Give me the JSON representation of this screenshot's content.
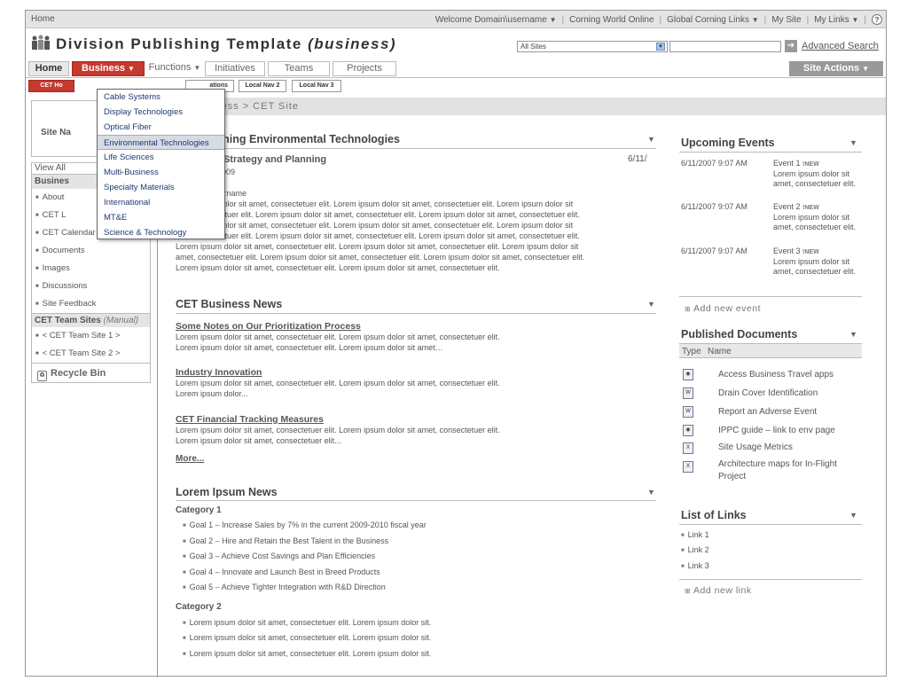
{
  "topbar": {
    "home": "Home",
    "welcome": "Welcome Domain\\username",
    "corning_world": "Corning World Online",
    "global_links": "Global Corning Links",
    "my_site": "My Site",
    "my_links": "My Links",
    "help": "?"
  },
  "header": {
    "title_plain": "Division Publishing Template",
    "title_italic": "(business)",
    "scope": "All Sites",
    "advanced_search": "Advanced Search"
  },
  "tabs": {
    "home": "Home",
    "business": "Business",
    "functions": "Functions",
    "initiatives": "Initiatives",
    "teams": "Teams",
    "projects": "Projects",
    "site_actions": "Site Actions"
  },
  "subnav": {
    "cet_home": "CET Ho",
    "operations": "ations",
    "local2": "Local Nav 2",
    "local3": "Local Nav 3"
  },
  "breadcrumb": "Business > CET Site",
  "dropdown": {
    "items": [
      "Cable Systems",
      "Display Technologies",
      "Optical Fiber",
      "Environmental Technologies",
      "Life Sciences",
      "Multi-Business",
      "Specialty Materials",
      "International",
      "MT&E",
      "Science & Technology"
    ]
  },
  "leftnav": {
    "site_nav": "Site Na",
    "view_all": "View All",
    "section_head": "Busines",
    "items": [
      "About",
      "CET L",
      "CET Calendar",
      "Documents",
      "Images",
      "Discussions",
      "Site Feedback"
    ],
    "team_head": "CET Team Sites",
    "team_head_note": "(Manual)",
    "team_sites": [
      "< CET Team Site 1 >",
      "< CET Team Site 2 >"
    ],
    "recycle": "Recycle Bin"
  },
  "main": {
    "cet_title": "t Corning Environmental Technologies",
    "article_title": "-Year Strategy and Planning",
    "article_date": "6/11/",
    "article_sub": "mber 2009",
    "article_author": "ain\\Username",
    "article_lines": [
      "psum dolor sit amet, consectetuer elit. Lorem ipsum dolor sit amet, consectetuer elit. Lorem ipsum dolor sit",
      "onsectetuer elit. Lorem ipsum dolor sit amet, consectetuer elit.  Lorem ipsum dolor sit amet, consectetuer elit.",
      "psum dolor sit amet, consectetuer elit. Lorem ipsum dolor sit amet, consectetuer elit. Lorem ipsum dolor sit",
      "onsectetuer elit.  Lorem ipsum dolor sit amet, consectetuer elit. Lorem ipsum dolor sit amet, consectetuer elit.",
      "Lorem ipsum dolor sit amet, consectetuer elit. Lorem ipsum dolor sit amet, consectetuer elit.  Lorem ipsum dolor sit",
      "amet, consectetuer elit. Lorem ipsum dolor sit amet, consectetuer elit. Lorem ipsum dolor sit amet, consectetuer elit.",
      "Lorem ipsum dolor sit amet, consectetuer elit.  Lorem ipsum dolor sit amet, consectetuer elit."
    ],
    "news_title": "CET Business News",
    "news": [
      {
        "title": "Some Notes on Our Prioritization Process",
        "l1": "Lorem ipsum dolor sit amet, consectetuer elit. Lorem ipsum dolor sit amet, consectetuer elit.",
        "l2": "Lorem ipsum dolor sit amet, consectetuer elit. Lorem ipsum dolor sit amet…"
      },
      {
        "title": "Industry Innovation",
        "l1": "Lorem ipsum dolor sit amet, consectetuer elit. Lorem ipsum dolor sit amet, consectetuer elit.",
        "l2": "Lorem ipsum dolor..."
      },
      {
        "title": "CET Financial Tracking Measures",
        "l1": "Lorem ipsum dolor sit amet, consectetuer elit. Lorem ipsum dolor sit amet, consectetuer elit.",
        "l2": "Lorem ipsum dolor sit amet, consectetuer elit..."
      }
    ],
    "more": "More...",
    "lorem_title": "Lorem Ipsum News",
    "cat1": "Category 1",
    "cat1_items": [
      "Goal 1 – Increase Sales by 7% in the current 2009-2010 fiscal year",
      "Goal 2 – Hire and Retain the Best Talent in the Business",
      "Goal 3 – Achieve Cost Savings and Plan Efficiencies",
      "Goal 4 – Innovate and Launch Best in Breed Products",
      "Goal 5 – Achieve Tighter Integration with R&D Direction"
    ],
    "cat2": "Category 2",
    "cat2_items": [
      "Lorem ipsum dolor sit amet, consectetuer elit. Lorem ipsum dolor sit.",
      "Lorem ipsum dolor sit amet, consectetuer elit. Lorem ipsum dolor sit.",
      "Lorem ipsum dolor sit amet, consectetuer elit. Lorem ipsum dolor sit."
    ]
  },
  "right": {
    "events_title": "Upcoming Events",
    "events": [
      {
        "date": "6/11/2007 9:07 AM",
        "name": "Event 1",
        "new": "!NEW",
        "desc": "Lorem ipsum dolor sit amet, consectetuer elit."
      },
      {
        "date": "6/11/2007 9:07 AM",
        "name": "Event 2",
        "new": "!NEW",
        "desc": "Lorem ipsum dolor sit amet, consectetuer elit."
      },
      {
        "date": "6/11/2007 9:07 AM",
        "name": "Event 3",
        "new": "!NEW",
        "desc": "Lorem ipsum dolor sit amet, consectetuer elit."
      }
    ],
    "add_event": "Add new event",
    "docs_title": "Published Documents",
    "docs_col_type": "Type",
    "docs_col_name": "Name",
    "docs": [
      "Access Business Travel apps",
      "Drain Cover Identification",
      "Report an Adverse Event",
      "IPPC guide – link to env page",
      "Site Usage Metrics",
      "Architecture maps for In-Flight Project"
    ],
    "links_title": "List of Links",
    "links": [
      "Link 1",
      "Link 2",
      "Link 3"
    ],
    "add_link": "Add new link"
  },
  "colors": {
    "accent": "#c6392f",
    "link": "#1d3a70"
  }
}
